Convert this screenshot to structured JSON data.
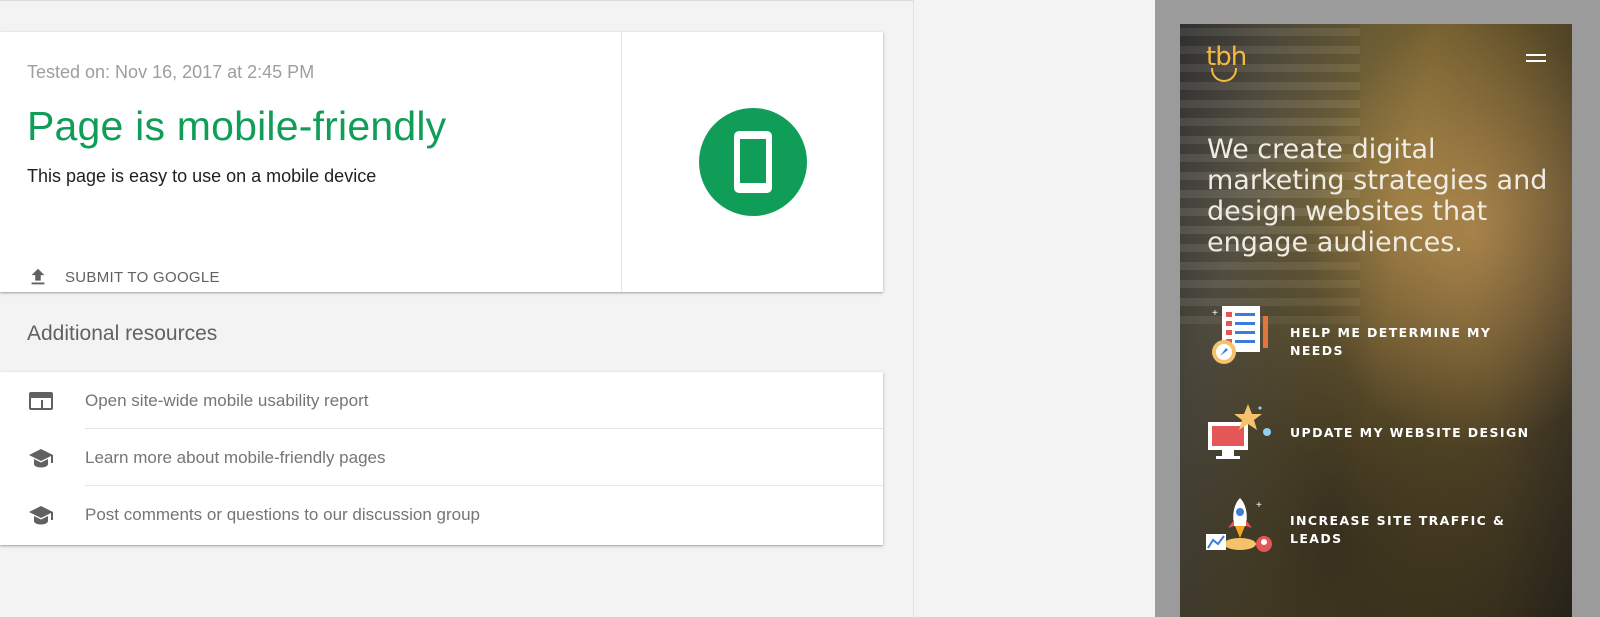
{
  "result": {
    "tested_on": "Tested on: Nov 16, 2017 at 2:45 PM",
    "headline": "Page is mobile-friendly",
    "description": "This page is easy to use on a mobile device",
    "submit_label": "SUBMIT TO GOOGLE",
    "accent_color": "#0f9d58",
    "status_icon": "smartphone-icon"
  },
  "resources": {
    "heading": "Additional resources",
    "items": [
      {
        "label": "Open site-wide mobile usability report",
        "icon": "report-window-icon"
      },
      {
        "label": "Learn more about mobile-friendly pages",
        "icon": "graduation-cap-icon"
      },
      {
        "label": "Post comments or questions to our discussion group",
        "icon": "graduation-cap-icon"
      }
    ]
  },
  "mobile_preview": {
    "logo_text": "tbh",
    "logo_color": "#f5b942",
    "menu_icon": "hamburger-menu-icon",
    "hero_text": "We create digital marketing strategies and design websites that engage audiences.",
    "ctas": [
      {
        "label": "HELP ME DETERMINE MY NEEDS",
        "icon": "checklist-compass-icon"
      },
      {
        "label": "UPDATE MY WEBSITE DESIGN",
        "icon": "monitor-star-icon"
      },
      {
        "label": "INCREASE SITE TRAFFIC & LEADS",
        "icon": "rocket-chart-icon"
      }
    ]
  }
}
